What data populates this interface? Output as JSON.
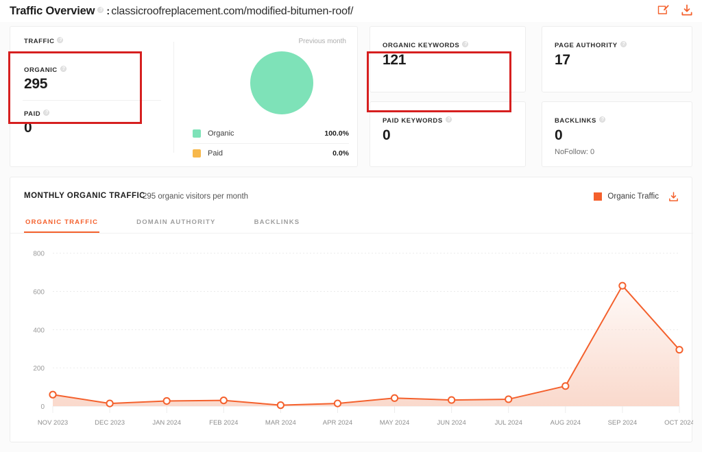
{
  "header": {
    "title": "Traffic Overview",
    "separator": ":",
    "url": "classicroofreplacement.com/modified-bitumen-roof/",
    "icons": [
      "edit-note-icon",
      "download-icon"
    ]
  },
  "cards": {
    "traffic": {
      "label": "TRAFFIC",
      "organic_label": "ORGANIC",
      "organic_value": "295",
      "paid_label": "PAID",
      "paid_value": "0",
      "previous_month": "Previous month",
      "legend": [
        {
          "name": "Organic",
          "percent": "100.0%",
          "color": "#7EE2B8"
        },
        {
          "name": "Paid",
          "percent": "0.0%",
          "color": "#F7B84B"
        }
      ]
    },
    "organic_keywords": {
      "label": "ORGANIC KEYWORDS",
      "value": "121"
    },
    "paid_keywords": {
      "label": "PAID KEYWORDS",
      "value": "0"
    },
    "page_authority": {
      "label": "PAGE AUTHORITY",
      "value": "17"
    },
    "backlinks": {
      "label": "BACKLINKS",
      "value": "0",
      "sub": "NoFollow: 0"
    }
  },
  "annotations": [
    {
      "name": "traffic-organic-highlight",
      "color": "#d61f1f"
    },
    {
      "name": "organic-keywords-highlight",
      "color": "#d61f1f"
    }
  ],
  "panel": {
    "title": "MONTHLY ORGANIC TRAFFIC",
    "subtitle": "295 organic visitors per month",
    "legend_label": "Organic Traffic",
    "download_icon": "download-icon",
    "tabs": [
      {
        "label": "ORGANIC TRAFFIC",
        "active": true
      },
      {
        "label": "DOMAIN AUTHORITY",
        "active": false
      },
      {
        "label": "BACKLINKS",
        "active": false
      }
    ]
  },
  "chart_data": {
    "type": "area",
    "title": "MONTHLY ORGANIC TRAFFIC",
    "xlabel": "",
    "ylabel": "",
    "categories": [
      "NOV 2023",
      "DEC 2023",
      "JAN 2024",
      "FEB 2024",
      "MAR 2024",
      "APR 2024",
      "MAY 2024",
      "JUN 2024",
      "JUL 2024",
      "AUG 2024",
      "SEP 2024",
      "OCT 2024"
    ],
    "series": [
      {
        "name": "Organic Traffic",
        "color": "#F4602C",
        "values": [
          60,
          14,
          27,
          30,
          5,
          14,
          42,
          32,
          36,
          105,
          630,
          295
        ]
      }
    ],
    "yticks": [
      0,
      200,
      400,
      600,
      800
    ],
    "ylim": [
      0,
      860
    ],
    "grid": true,
    "legend_position": "top-right",
    "marker": "open-circle",
    "fill": "#FAD9CC"
  }
}
